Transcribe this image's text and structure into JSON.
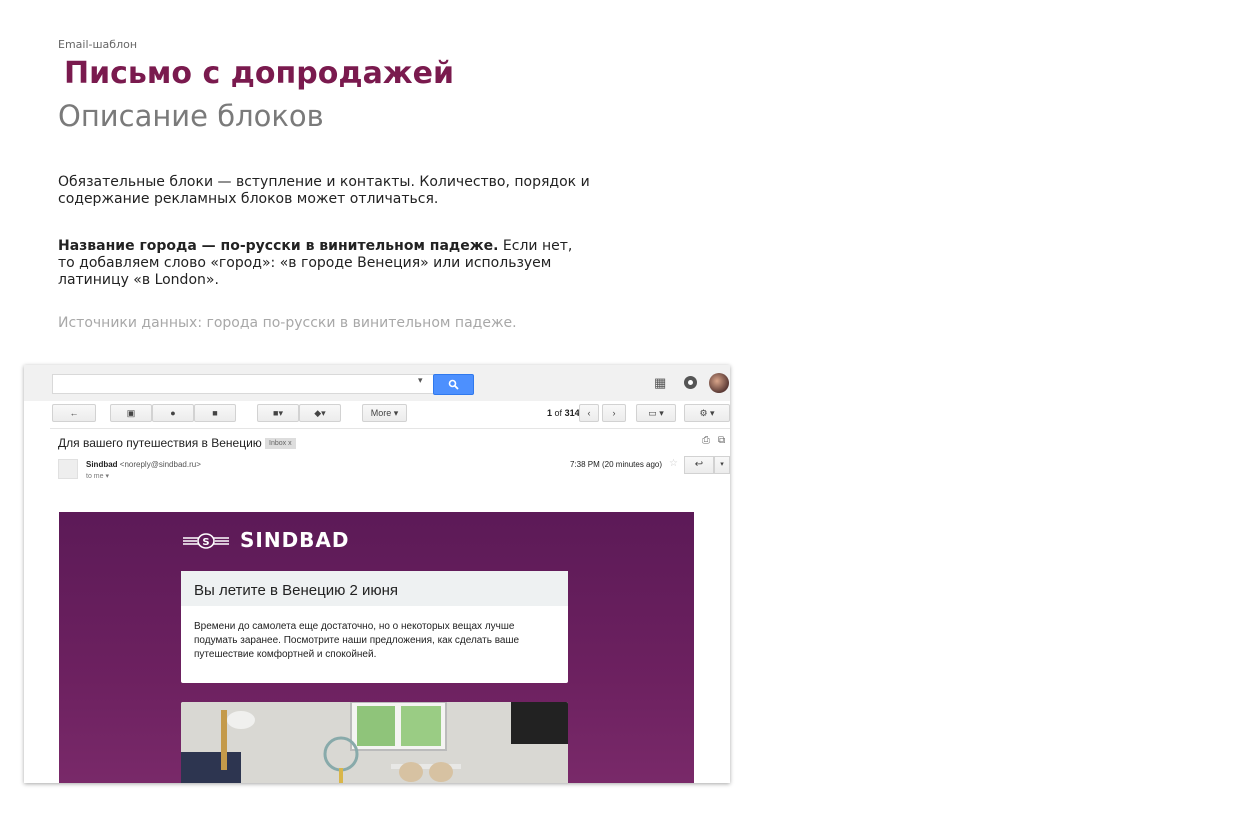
{
  "doc": {
    "kicker": "Email-шаблон",
    "title": "Письмо с допродажей",
    "subtitle": "Описание блоков",
    "para1": "Обязательные блоки — вступление и контакты. Количество, порядок и содержание рекламных блоков может отличаться.",
    "para2_bold": "Название города — по-русски в винительном падеже.",
    "para2_rest": " Если нет, то добавляем слово «город»: «в городе Венеция» или используем латиницу «в London».",
    "para3": "Источники данных: города по-русски в винительном падеже."
  },
  "gmail": {
    "search_button_icon": "search-icon",
    "toolbar": {
      "more_label": "More",
      "count_current": "1",
      "count_of": "of",
      "count_total": "314"
    },
    "subject": "Для вашего путешествия в Венецию",
    "label": "Inbox",
    "sender_name": "Sindbad",
    "sender_email": "<noreply@sindbad.ru>",
    "to_me": "to me",
    "time": "7:38 PM (20 minutes ago)"
  },
  "email": {
    "brand": "SINDBAD",
    "card_title": "Вы летите в Венецию 2 июня",
    "card_text": "Времени до самолета еще достаточно, но о некоторых вещах лучше подумать заранее. Посмотрите наши предложения, как сделать ваше путешествие комфортней и спокойней."
  },
  "colors": {
    "title": "#7a1a4e",
    "email_bg": "#6d2160",
    "search_button": "#4d90fe"
  }
}
